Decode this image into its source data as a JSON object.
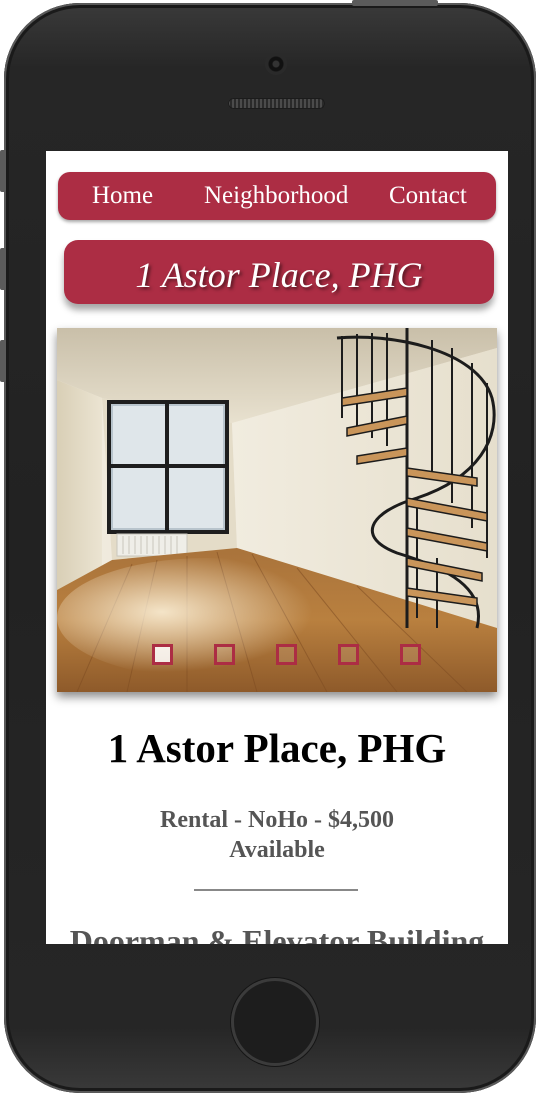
{
  "nav": {
    "items": [
      {
        "label": "Home"
      },
      {
        "label": "Neighborhood"
      },
      {
        "label": "Contact"
      }
    ]
  },
  "banner": {
    "title": "1 Astor Place, PHG"
  },
  "carousel": {
    "slide_count": 5,
    "active_index": 0
  },
  "listing": {
    "title": "1 Astor Place, PHG",
    "details": "Rental - NoHo - $4,500",
    "status": "Available",
    "features_heading": "Doorman & Elevator Building"
  },
  "colors": {
    "brand": "#ac2d44",
    "device_body": "#262626",
    "subtext": "#555555"
  }
}
